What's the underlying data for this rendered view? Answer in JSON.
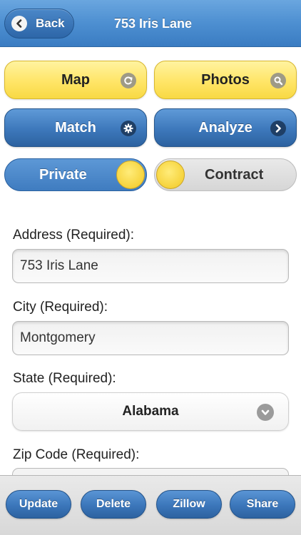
{
  "header": {
    "back_label": "Back",
    "title": "753 Iris Lane"
  },
  "actions": {
    "map": "Map",
    "photos": "Photos",
    "match": "Match",
    "analyze": "Analyze"
  },
  "toggles": {
    "private_label": "Private",
    "private_state": "on",
    "contract_label": "Contract",
    "contract_state": "off"
  },
  "form": {
    "address_label": "Address (Required):",
    "address_value": "753 Iris Lane",
    "city_label": "City (Required):",
    "city_value": "Montgomery",
    "state_label": "State (Required):",
    "state_value": "Alabama",
    "zip_label": "Zip Code (Required):"
  },
  "footer": {
    "update": "Update",
    "delete": "Delete",
    "zillow": "Zillow",
    "share": "Share"
  },
  "colors": {
    "header_blue": "#4d8fd1",
    "button_yellow": "#ffe567",
    "button_blue": "#3d78bb",
    "knob_yellow": "#f6d33c"
  },
  "icons": {
    "back": "chevron-left-icon",
    "map": "arrow-circle-icon",
    "photos": "search-icon",
    "match": "gear-icon",
    "analyze": "chevron-right-icon",
    "state": "chevron-down-icon"
  }
}
